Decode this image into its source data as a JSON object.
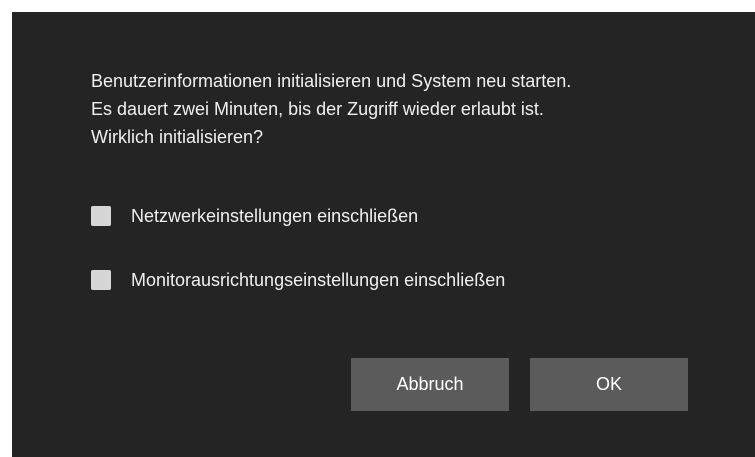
{
  "dialog": {
    "message_lines": [
      "Benutzerinformationen initialisieren und System neu starten.",
      "Es dauert zwei Minuten, bis der Zugriff wieder erlaubt ist.",
      "Wirklich initialisieren?"
    ],
    "options": [
      {
        "label": "Netzwerkeinstellungen einschließen",
        "checked": false
      },
      {
        "label": "Monitorausrichtungseinstellungen einschließen",
        "checked": false
      }
    ],
    "buttons": {
      "cancel_label": "Abbruch",
      "ok_label": "OK"
    }
  },
  "colors": {
    "dialog_background": "#242424",
    "text": "#f0f0f0",
    "checkbox": "#d6d6d6",
    "button": "#5b5b5b"
  }
}
